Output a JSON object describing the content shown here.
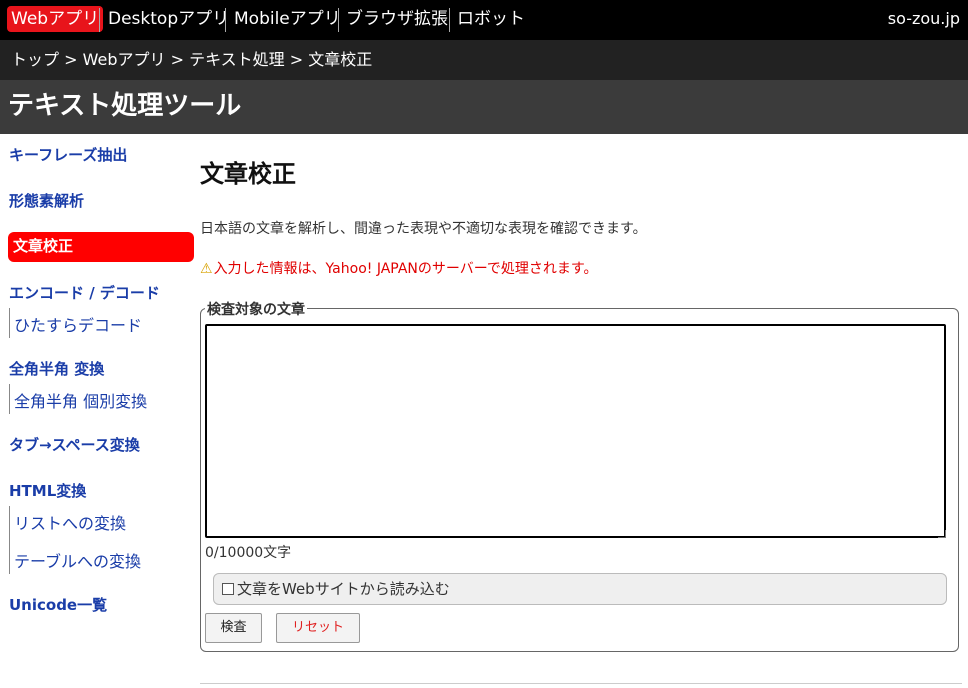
{
  "topnav": {
    "items": [
      "Webアプリ",
      "Desktopアプリ",
      "Mobileアプリ",
      "ブラウザ拡張",
      "ロボット"
    ],
    "site_name": "so-zou.jp"
  },
  "breadcrumb": [
    "トップ",
    ">",
    "Webアプリ",
    ">",
    "テキスト処理",
    ">",
    "文章校正"
  ],
  "section_title": "テキスト処理ツール",
  "sidebar": {
    "keyphrase": "キーフレーズ抽出",
    "morph": "形態素解析",
    "proofread": "文章校正",
    "encode": "エンコード / デコード",
    "encode_sub": "ひたすらデコード",
    "zenhan": "全角半角 変換",
    "zenhan_sub": "全角半角 個別変換",
    "tab": "タブ→スペース変換",
    "html": "HTML変換",
    "html_sub1": "リストへの変換",
    "html_sub2": "テーブルへの変換",
    "unicode": "Unicode一覧"
  },
  "main": {
    "title": "文章校正",
    "description": "日本語の文章を解析し、間違った表現や不適切な表現を確認できます。",
    "warning": "入力した情報は、Yahoo! JAPANのサーバーで処理されます。",
    "form": {
      "legend": "検査対象の文章",
      "text_value": "",
      "char_count": "0/10000文字",
      "load_web_label": "文章をWebサイトから読み込む",
      "check_label": "検査",
      "reset_label": "リセット"
    }
  },
  "colors": {
    "nav_bg": "#000000",
    "breadcrumb_bg": "#222222",
    "header_bg": "#3b3b3b",
    "accent_red": "#ff0000",
    "link_blue": "#1a3da8"
  },
  "icons": {
    "warning": "warning-triangle-icon"
  }
}
